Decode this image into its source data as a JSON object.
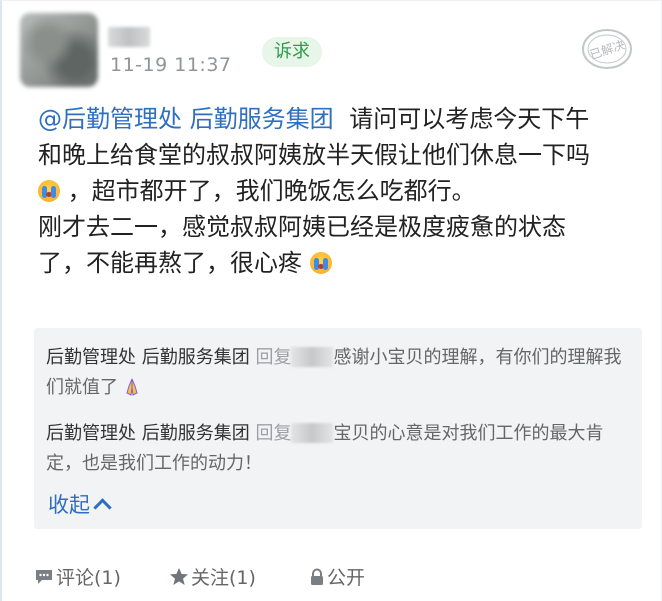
{
  "post": {
    "timestamp": "11-19 11:37",
    "tag": "诉求",
    "status_stamp": "已解决",
    "mention": "@后勤管理处 后勤服务集团",
    "body_line1_rest": "请问可以考虑今天下午",
    "body_line2": "和晚上给食堂的叔叔阿姨放半天假让他们休息一下吗",
    "body_line3": "，超市都开了，我们晚饭怎么吃都行。",
    "body_line4": "刚才去二一，感觉叔叔阿姨已经是极度疲惫的状态",
    "body_line5": "了，不能再熬了，很心疼"
  },
  "replies": {
    "items": [
      {
        "author": "后勤管理处 后勤服务集团",
        "reply_keyword": "回复",
        "text": "感谢小宝贝的理解，有你们的理解我们就值了"
      },
      {
        "author": "后勤管理处 后勤服务集团",
        "reply_keyword": "回复",
        "text": "宝贝的心意是对我们工作的最大肯定，也是我们工作的动力！"
      }
    ],
    "collapse_label": "收起"
  },
  "footer": {
    "comment_label": "评论(1)",
    "follow_label": "关注(1)",
    "visibility_label": "公开"
  },
  "colors": {
    "link_blue": "#2f6fc0",
    "tag_green": "#2d9c4a",
    "tag_bg": "#e8f6ea",
    "reply_bg": "#f2f3f5"
  },
  "icons": [
    "crying-emoji-icon",
    "praying-hands-icon",
    "chevron-up-icon",
    "comment-icon",
    "star-icon",
    "lock-icon",
    "resolved-stamp-icon"
  ]
}
